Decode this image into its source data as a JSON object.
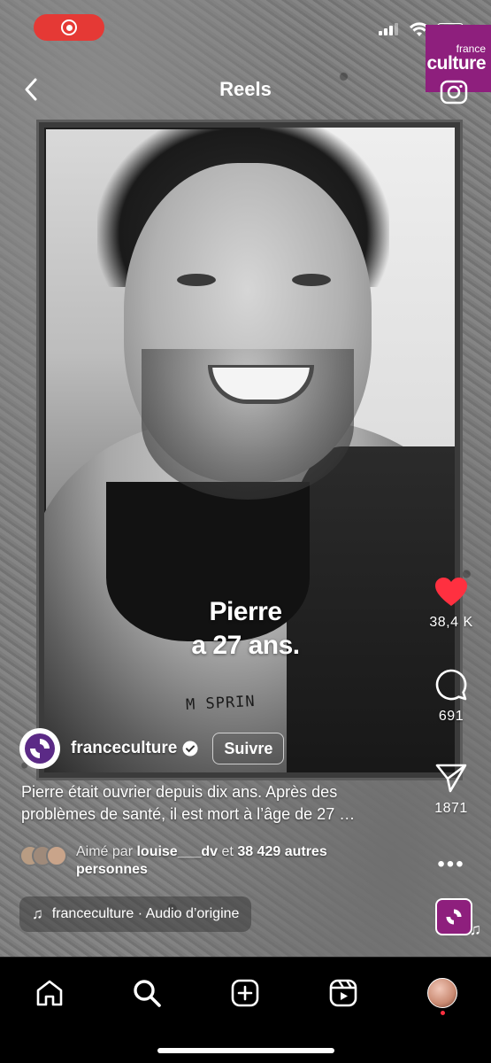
{
  "status_bar": {
    "recording": true
  },
  "brand_logo": {
    "small": "france",
    "big": "culture",
    "color": "#8e1f7d"
  },
  "header": {
    "title": "Reels"
  },
  "video": {
    "caption_line1": "Pierre",
    "caption_line2": "a 27 ans.",
    "shirt_text": "M SPRIN"
  },
  "actions": {
    "likes": "38,4 K",
    "comments": "691",
    "shares": "1871",
    "like_color": "#ff3040"
  },
  "author": {
    "username": "franceculture",
    "follow_label": "Suivre"
  },
  "post_caption": {
    "line1": "Pierre était ouvrier depuis dix ans. Après des",
    "line2": "problèmes de santé, il est mort à l’âge de 27 …"
  },
  "liked_by": {
    "prefix": "Aimé par ",
    "user": "louise___dv",
    "middle": " et ",
    "count": "38 429 autres",
    "suffix": "personnes"
  },
  "audio": {
    "label": "franceculture · Audio d’origine"
  },
  "bottom_nav": {
    "items": [
      "home-icon",
      "search-icon",
      "create-icon",
      "reels-icon",
      "profile-avatar"
    ],
    "notification_color": "#ff3040"
  }
}
